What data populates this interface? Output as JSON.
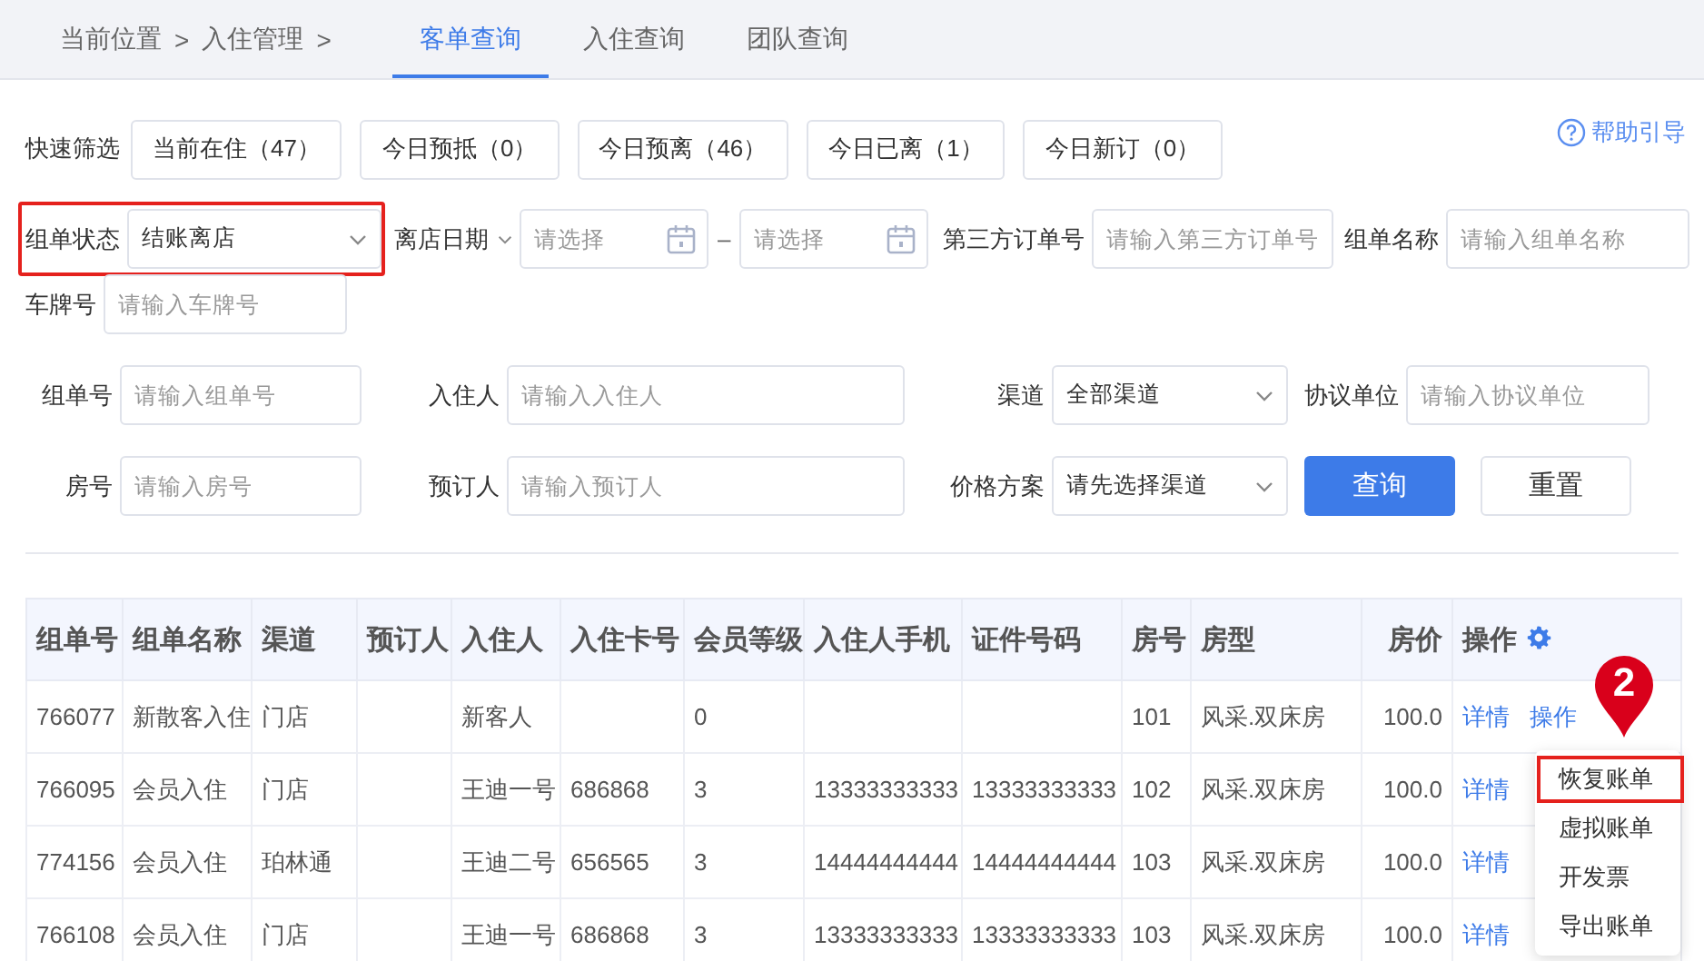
{
  "breadcrumb": [
    "当前位置",
    ">",
    "入住管理",
    ">"
  ],
  "tabs": [
    {
      "label": "客单查询",
      "selected": true
    },
    {
      "label": "入住查询",
      "selected": false
    },
    {
      "label": "团队查询",
      "selected": false
    }
  ],
  "quick_filter": {
    "label": "快速筛选",
    "chips": [
      "当前在住（47）",
      "今日预抵（0）",
      "今日预离（46）",
      "今日已离（1）",
      "今日新订（0）"
    ]
  },
  "help_link": "帮助引导",
  "filter_rows": [
    [
      {
        "kind": "select",
        "label": "组单状态",
        "value": "结账离店",
        "highlighted": true
      },
      {
        "kind": "date_range",
        "label": "离店日期",
        "placeholders": [
          "请选择",
          "请选择"
        ],
        "separator": "–"
      },
      {
        "kind": "input",
        "label": "第三方订单号",
        "placeholder": "请输入第三方订单号"
      },
      {
        "kind": "input",
        "label": "组单名称",
        "placeholder": "请输入组单名称"
      }
    ],
    [
      {
        "kind": "input",
        "label": "车牌号",
        "placeholder": "请输入车牌号"
      }
    ],
    [
      {
        "kind": "input",
        "label": "组单号",
        "placeholder": "请输入组单号"
      },
      {
        "kind": "input",
        "label": "入住人",
        "placeholder": "请输入入住人"
      },
      {
        "kind": "select",
        "label": "渠道",
        "value": "全部渠道",
        "highlighted": false
      },
      {
        "kind": "input",
        "label": "协议单位",
        "placeholder": "请输入协议单位"
      }
    ],
    [
      {
        "kind": "input",
        "label": "房号",
        "placeholder": "请输入房号"
      },
      {
        "kind": "input",
        "label": "预订人",
        "placeholder": "请输入预订人"
      },
      {
        "kind": "select",
        "label": "价格方案",
        "value": "请先选择渠道",
        "highlighted": false
      },
      {
        "kind": "button",
        "label": "查询",
        "primary": true
      },
      {
        "kind": "button",
        "label": "重置",
        "primary": false
      }
    ]
  ],
  "table": {
    "columns": [
      "组单号",
      "组单名称",
      "渠道",
      "预订人",
      "入住人",
      "入住卡号",
      "会员等级",
      "入住人手机",
      "证件号码",
      "房号",
      "房型",
      "房价",
      "操作"
    ],
    "rows": [
      {
        "cells": [
          "766077",
          "新散客入住",
          "门店",
          "",
          "新客人",
          "",
          "0",
          "",
          "",
          "101",
          "风采.双床房",
          "100.0"
        ],
        "actions": [
          "详情",
          "操作"
        ]
      },
      {
        "cells": [
          "766095",
          "会员入住",
          "门店",
          "",
          "王迪一号",
          "686868",
          "3",
          "13333333333",
          "13333333333",
          "102",
          "风采.双床房",
          "100.0"
        ],
        "actions": [
          "详情"
        ]
      },
      {
        "cells": [
          "774156",
          "会员入住",
          "珀林通",
          "",
          "王迪二号",
          "656565",
          "3",
          "14444444444",
          "14444444444",
          "103",
          "风采.双床房",
          "100.0"
        ],
        "actions": [
          "详情"
        ]
      },
      {
        "cells": [
          "766108",
          "会员入住",
          "门店",
          "",
          "王迪一号",
          "686868",
          "3",
          "13333333333",
          "13333333333",
          "103",
          "风采.双床房",
          "100.0"
        ],
        "actions": [
          "详情"
        ]
      }
    ]
  },
  "action_menu": [
    {
      "label": "恢复账单",
      "highlighted": true
    },
    {
      "label": "虚拟账单",
      "highlighted": false
    },
    {
      "label": "开发票",
      "highlighted": false
    },
    {
      "label": "导出账单",
      "highlighted": false
    }
  ],
  "callout": "2"
}
